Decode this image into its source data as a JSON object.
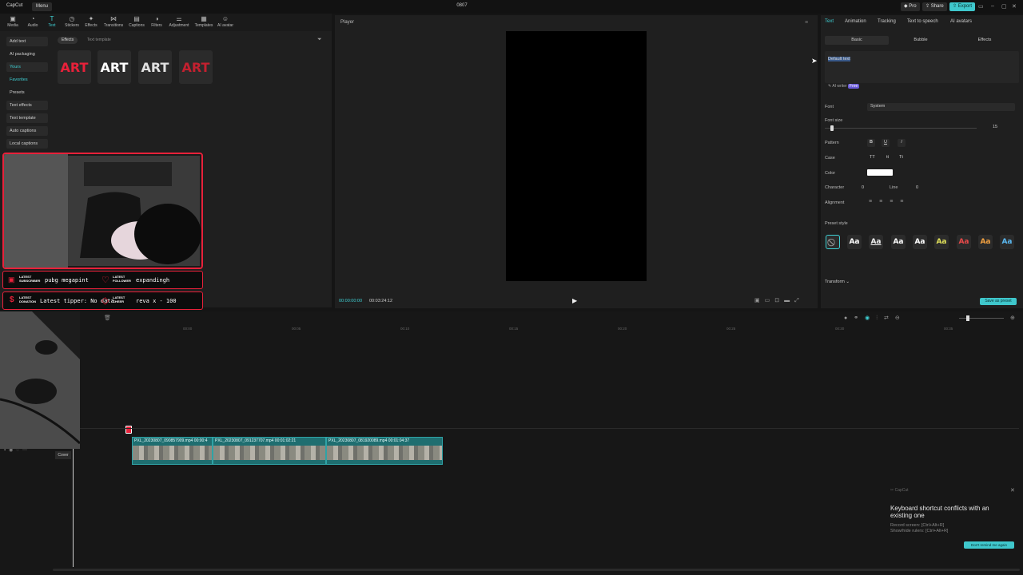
{
  "app": {
    "logo": "CapCut",
    "menu": "Menu",
    "project_title": "0807"
  },
  "topbar": {
    "pro": "Pro",
    "share": "Share",
    "export": "Export"
  },
  "tools": [
    {
      "label": "Media",
      "icon": "media-icon"
    },
    {
      "label": "Audio",
      "icon": "audio-icon"
    },
    {
      "label": "Text",
      "icon": "text-icon",
      "active": true
    },
    {
      "label": "Stickers",
      "icon": "stickers-icon"
    },
    {
      "label": "Effects",
      "icon": "effects-icon"
    },
    {
      "label": "Transitions",
      "icon": "transitions-icon"
    },
    {
      "label": "Captions",
      "icon": "captions-icon"
    },
    {
      "label": "Filters",
      "icon": "filters-icon"
    },
    {
      "label": "Adjustment",
      "icon": "adjustment-icon"
    },
    {
      "label": "Templates",
      "icon": "templates-icon"
    },
    {
      "label": "AI avatar",
      "icon": "ai-avatar-icon"
    }
  ],
  "sidenav": {
    "items": [
      "Add text",
      "AI packaging",
      "Yours",
      "Favorites",
      "Presets",
      "Text effects",
      "Text template",
      "Auto captions",
      "Local captions"
    ]
  },
  "text_panel": {
    "chips": [
      "Effects",
      "Text template"
    ],
    "cards": [
      "ART",
      "ART",
      "ART",
      "ART"
    ]
  },
  "overlay": {
    "subscriber_label": "LATEST SUBSCRIBER",
    "subscriber_value": "pubg megapint",
    "follower_label": "LATEST FOLLOWER",
    "follower_value": "expandingh",
    "donation_label": "LATEST DONATION",
    "donation_value": "Latest tipper: No data",
    "cheer_label": "LATEST CHEER",
    "cheer_value": "reva x - 100"
  },
  "player": {
    "title": "Player",
    "time_current": "00:00:00:00",
    "time_total": "00:03:24:12",
    "accent": "#3fd0d4"
  },
  "inspector": {
    "tabs": [
      "Text",
      "Animation",
      "Tracking",
      "Text to speech",
      "AI avatars"
    ],
    "subtabs": [
      "Basic",
      "Bubble",
      "Effects"
    ],
    "default_text": "Default text",
    "ai_writer": "AI writer",
    "ai_writer_badge": "Free",
    "font_label": "Font",
    "font_value": "System",
    "font_size_label": "Font size",
    "font_size_value": "15",
    "pattern_label": "Pattern",
    "pattern_buttons": [
      "B",
      "U",
      "I"
    ],
    "case_label": "Case",
    "case_buttons": [
      "TT",
      "tt",
      "Tt"
    ],
    "color_label": "Color",
    "character_label": "Character",
    "character_value": "0",
    "line_label": "Line",
    "line_value": "0",
    "alignment_label": "Alignment",
    "preset_style_label": "Preset style",
    "presets": [
      "Aa",
      "Aa",
      "Aa",
      "Aa",
      "Aa",
      "Aa",
      "Aa",
      "Aa"
    ],
    "transform_label": "Transform",
    "save_preset": "Save as preset"
  },
  "timeline": {
    "ticks": [
      "00:00",
      "00:05",
      "00:10",
      "00:15",
      "00:20",
      "00:25",
      "00:30",
      "00:35",
      "00:40"
    ],
    "clips": [
      {
        "label": "PXL_20230807_090857909.mp4  00:00:4"
      },
      {
        "label": "PXL_20230807_091237707.mp4  00:01:02:21"
      },
      {
        "label": "PXL_20230807_081920089.mp4  00:01:04:37"
      }
    ],
    "cover": "Cover"
  },
  "toast": {
    "app": "CapCut",
    "title": "Keyboard shortcut conflicts with an existing one",
    "line1": "Record screen: [Ctrl+Alt+R]",
    "line2": "Show/hide rulers: [Ctrl+Alt+R]",
    "button": "Don't remind me again"
  }
}
